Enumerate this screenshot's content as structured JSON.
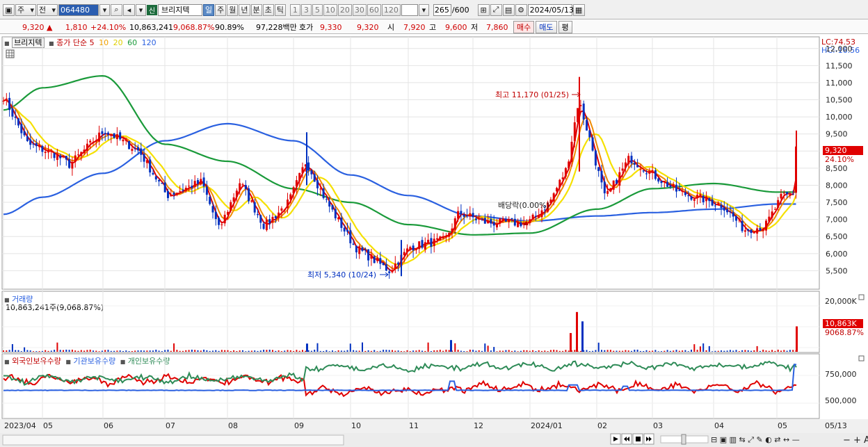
{
  "toolbar": {
    "market": "주",
    "market2": "전",
    "code": "064480",
    "name_tag": "신",
    "name": "브리지텍",
    "periods": [
      "일",
      "주",
      "월",
      "년",
      "분",
      "초",
      "틱"
    ],
    "selected_period": "일",
    "ticks": [
      "1",
      "3",
      "5",
      "10",
      "20",
      "30",
      "60",
      "120"
    ],
    "count": "265",
    "count_max": "/600",
    "date": "2024/05/13"
  },
  "quote": {
    "price": "9,320",
    "arrow": "▲",
    "change": "1,810",
    "change_pct": "+24.10%",
    "volume": "10,863,241",
    "volume_pct": "9,068.87%",
    "ratio": "90.89%",
    "amount": "97,228백만",
    "hoga_label": "호가",
    "ask": "9,330",
    "bid": "9,320",
    "open_label": "시",
    "open": "7,920",
    "high_label": "고",
    "high": "9,600",
    "low_label": "저",
    "low": "7,860",
    "buy_btn": "매수",
    "sell_btn": "매도",
    "eval_btn": "평"
  },
  "legend": {
    "name": "브리지텍",
    "ma_label": "종가 단순",
    "ma5": "5",
    "ma10": "10",
    "ma20": "20",
    "ma60": "60",
    "ma120": "120"
  },
  "price_panel": {
    "lc": "LC:74.53",
    "hc": "HC:-16.56",
    "y_ticks": [
      "12,000",
      "11,500",
      "11,000",
      "10,500",
      "10,000",
      "9,500",
      "9,000",
      "8,500",
      "8,000",
      "7,500",
      "7,000",
      "6,500",
      "6,000",
      "5,500"
    ],
    "current_price": "9,320",
    "current_pct": "24.10%",
    "high_annotation": "최고 11,170 (01/25)",
    "low_annotation": "최저 5,340 (10/24)",
    "dividend_annotation": "배당락(0.00%)"
  },
  "volume_panel": {
    "title": "거래량",
    "value": "10,863,241주(9,068.87%)",
    "y_tick": "20,000K",
    "current_value": "10,863K",
    "current_pct": "9068.87%"
  },
  "holder_panel": {
    "foreign": "외국인보유수량",
    "institution": "기관보유수량",
    "individual": "개인보유수량",
    "y_ticks": [
      "750,000",
      "500,000"
    ]
  },
  "x_axis": {
    "labels": [
      "2023/04",
      "05",
      "06",
      "07",
      "08",
      "09",
      "10",
      "11",
      "12",
      "2024/01",
      "02",
      "03",
      "04",
      "05"
    ],
    "right_label": "05/13"
  },
  "colors": {
    "up": "#e00000",
    "down": "#0030c0",
    "ma5": "#e00000",
    "ma10": "#f08a00",
    "ma20": "#f5e000",
    "ma60": "#1a9a3a",
    "ma120": "#2a60e0",
    "foreign": "#e00000",
    "institution": "#2a60e0",
    "individual": "#2e8b57"
  },
  "chart_data": {
    "type": "candlestick",
    "x_start": "2023/04",
    "x_end": "2024/05/13",
    "ylim": [
      5000,
      12300
    ],
    "ma_close": [
      {
        "x": "2023/04",
        "ma120": 7150,
        "ma60": 10200,
        "ma20": 11300
      },
      {
        "x": "05",
        "ma120": 7650,
        "ma60": 10850,
        "ma20": 9500
      },
      {
        "x": "06",
        "ma120": 8350,
        "ma60": 11200,
        "ma20": 9050
      },
      {
        "x": "07",
        "ma120": 9300,
        "ma60": 9200,
        "ma20": 8400
      },
      {
        "x": "08",
        "ma120": 9800,
        "ma60": 8700,
        "ma20": 8200
      },
      {
        "x": "09",
        "ma120": 9300,
        "ma60": 7900,
        "ma20": 7700
      },
      {
        "x": "10",
        "ma120": 8300,
        "ma60": 7500,
        "ma20": 6700
      },
      {
        "x": "11",
        "ma120": 7700,
        "ma60": 6850,
        "ma20": 5900
      },
      {
        "x": "12",
        "ma120": 7100,
        "ma60": 6550,
        "ma20": 6800
      },
      {
        "x": "2024/01",
        "ma120": 6950,
        "ma60": 6600,
        "ma20": 7000
      },
      {
        "x": "02",
        "ma120": 7100,
        "ma60": 7300,
        "ma20": 8600
      },
      {
        "x": "03",
        "ma120": 7200,
        "ma60": 7900,
        "ma20": 8100
      },
      {
        "x": "04",
        "ma120": 7300,
        "ma60": 8050,
        "ma20": 7400
      },
      {
        "x": "05",
        "ma120": 7450,
        "ma60": 7800,
        "ma20": 7000
      }
    ],
    "volume_annotation": {
      "x": "2024/05/13",
      "value_k": 10863
    }
  }
}
